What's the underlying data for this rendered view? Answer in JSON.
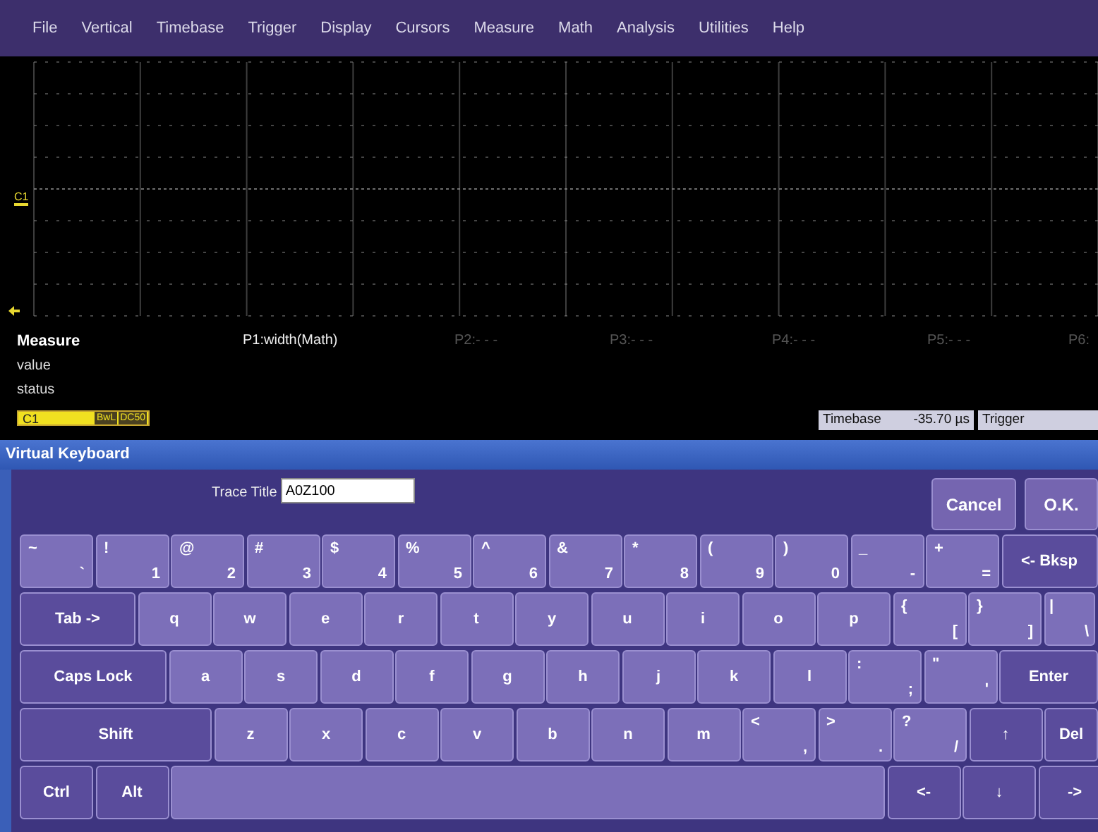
{
  "menu": [
    "File",
    "Vertical",
    "Timebase",
    "Trigger",
    "Display",
    "Cursors",
    "Measure",
    "Math",
    "Analysis",
    "Utilities",
    "Help"
  ],
  "scope": {
    "channel_marker": "C1"
  },
  "measure": {
    "title": "Measure",
    "row_labels": [
      "value",
      "status"
    ],
    "params": [
      "P1:width(Math)",
      "P2:- - -",
      "P3:- - -",
      "P4:- - -",
      "P5:- - -",
      "P6:"
    ]
  },
  "channel": {
    "name": "C1",
    "tags": [
      "BwL",
      "DC50"
    ]
  },
  "timebase": {
    "label": "Timebase",
    "value": "-35.70 µs"
  },
  "trigger": {
    "label": "Trigger"
  },
  "keyboard": {
    "title": "Virtual Keyboard",
    "field_label": "Trace Title",
    "field_value": "A0Z100",
    "buttons": [
      "Cancel",
      "O.K."
    ],
    "key_rows": [
      [
        {
          "kind": "dual",
          "shift": "~",
          "base": "`"
        },
        {
          "kind": "dual",
          "shift": "!",
          "base": "1"
        },
        {
          "kind": "dual",
          "shift": "@",
          "base": "2"
        },
        {
          "kind": "dual",
          "shift": "#",
          "base": "3"
        },
        {
          "kind": "dual",
          "shift": "$",
          "base": "4"
        },
        {
          "kind": "dual",
          "shift": "%",
          "base": "5"
        },
        {
          "kind": "dual",
          "shift": "^",
          "base": "6"
        },
        {
          "kind": "dual",
          "shift": "&",
          "base": "7"
        },
        {
          "kind": "dual",
          "shift": "*",
          "base": "8"
        },
        {
          "kind": "dual",
          "shift": "(",
          "base": "9"
        },
        {
          "kind": "dual",
          "shift": ")",
          "base": "0"
        },
        {
          "kind": "dual",
          "shift": "_",
          "base": "-"
        },
        {
          "kind": "dual",
          "shift": "+",
          "base": "="
        },
        {
          "kind": "special",
          "label": "<- Bksp"
        }
      ],
      [
        {
          "kind": "special",
          "label": "Tab ->"
        },
        {
          "kind": "letter",
          "label": "q"
        },
        {
          "kind": "letter",
          "label": "w"
        },
        {
          "kind": "letter",
          "label": "e"
        },
        {
          "kind": "letter",
          "label": "r"
        },
        {
          "kind": "letter",
          "label": "t"
        },
        {
          "kind": "letter",
          "label": "y"
        },
        {
          "kind": "letter",
          "label": "u"
        },
        {
          "kind": "letter",
          "label": "i"
        },
        {
          "kind": "letter",
          "label": "o"
        },
        {
          "kind": "letter",
          "label": "p"
        },
        {
          "kind": "dual",
          "shift": "{",
          "base": "["
        },
        {
          "kind": "dual",
          "shift": "}",
          "base": "]"
        },
        {
          "kind": "dual",
          "shift": "|",
          "base": "\\"
        }
      ],
      [
        {
          "kind": "special",
          "label": "Caps Lock"
        },
        {
          "kind": "letter",
          "label": "a"
        },
        {
          "kind": "letter",
          "label": "s"
        },
        {
          "kind": "letter",
          "label": "d"
        },
        {
          "kind": "letter",
          "label": "f"
        },
        {
          "kind": "letter",
          "label": "g"
        },
        {
          "kind": "letter",
          "label": "h"
        },
        {
          "kind": "letter",
          "label": "j"
        },
        {
          "kind": "letter",
          "label": "k"
        },
        {
          "kind": "letter",
          "label": "l"
        },
        {
          "kind": "dual",
          "shift": ":",
          "base": ";"
        },
        {
          "kind": "dual",
          "shift": "\"",
          "base": "'"
        },
        {
          "kind": "special",
          "label": "Enter"
        }
      ],
      [
        {
          "kind": "special",
          "label": "Shift"
        },
        {
          "kind": "letter",
          "label": "z"
        },
        {
          "kind": "letter",
          "label": "x"
        },
        {
          "kind": "letter",
          "label": "c"
        },
        {
          "kind": "letter",
          "label": "v"
        },
        {
          "kind": "letter",
          "label": "b"
        },
        {
          "kind": "letter",
          "label": "n"
        },
        {
          "kind": "letter",
          "label": "m"
        },
        {
          "kind": "dual",
          "shift": "<",
          "base": ","
        },
        {
          "kind": "dual",
          "shift": ">",
          "base": "."
        },
        {
          "kind": "dual",
          "shift": "?",
          "base": "/"
        },
        {
          "kind": "special",
          "label": "↑"
        },
        {
          "kind": "special",
          "label": "Del"
        }
      ],
      [
        {
          "kind": "special",
          "label": "Ctrl"
        },
        {
          "kind": "special",
          "label": "Alt"
        },
        {
          "kind": "space"
        },
        {
          "kind": "special",
          "label": "<-"
        },
        {
          "kind": "special",
          "label": "↓"
        },
        {
          "kind": "special",
          "label": "->"
        }
      ]
    ]
  }
}
